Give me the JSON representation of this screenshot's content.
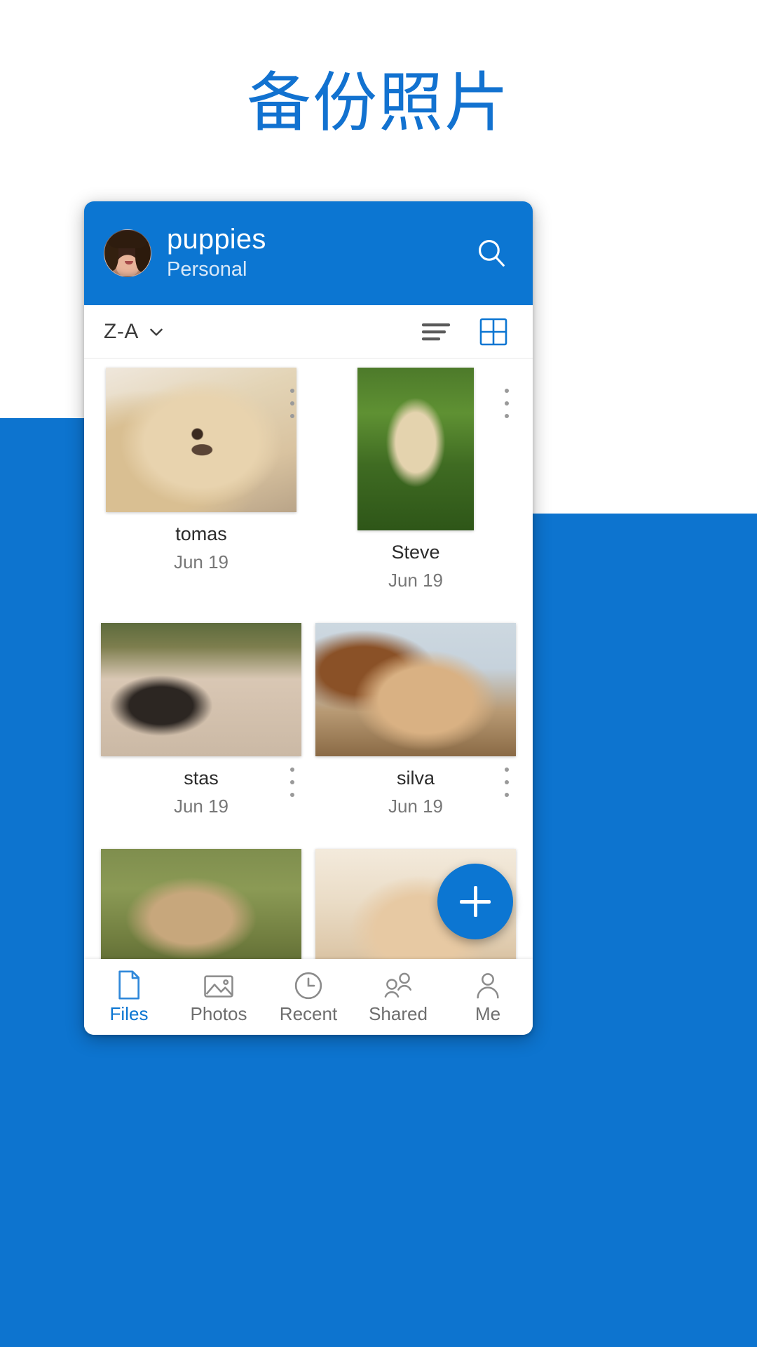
{
  "page": {
    "headline": "备份照片",
    "accent_color": "#0c76d2",
    "headline_color": "#1272d0",
    "background_top_color": "#ffffff",
    "background_bottom_color": "#0d74cf"
  },
  "app_header": {
    "title": "puppies",
    "subtitle": "Personal",
    "avatar_name": "user-avatar",
    "search_icon": "search-icon"
  },
  "toolbar": {
    "sort_label": "Z-A",
    "sort_chevron_icon": "chevron-down-icon",
    "list_view_icon": "list-view-icon",
    "grid_view_icon": "grid-view-icon",
    "active_view": "grid"
  },
  "files": [
    {
      "name": "tomas",
      "date": "Jun 19",
      "thumb_class": "ph1",
      "menu_icon": "overflow-menu-icon"
    },
    {
      "name": "Steve",
      "date": "Jun 19",
      "thumb_class": "ph2",
      "menu_icon": "overflow-menu-icon"
    },
    {
      "name": "stas",
      "date": "Jun 19",
      "thumb_class": "ph3",
      "menu_icon": "overflow-menu-icon"
    },
    {
      "name": "silva",
      "date": "Jun 19",
      "thumb_class": "ph4",
      "menu_icon": "overflow-menu-icon"
    },
    {
      "name": "",
      "date": "",
      "thumb_class": "ph5",
      "menu_icon": "overflow-menu-icon"
    },
    {
      "name": "",
      "date": "",
      "thumb_class": "ph6",
      "menu_icon": "overflow-menu-icon"
    }
  ],
  "fab": {
    "label": "+",
    "icon": "plus-icon"
  },
  "bottom_nav": {
    "items": [
      {
        "label": "Files",
        "icon": "file-icon",
        "active": true
      },
      {
        "label": "Photos",
        "icon": "photo-icon",
        "active": false
      },
      {
        "label": "Recent",
        "icon": "clock-icon",
        "active": false
      },
      {
        "label": "Shared",
        "icon": "people-icon",
        "active": false
      },
      {
        "label": "Me",
        "icon": "person-icon",
        "active": false
      }
    ]
  }
}
